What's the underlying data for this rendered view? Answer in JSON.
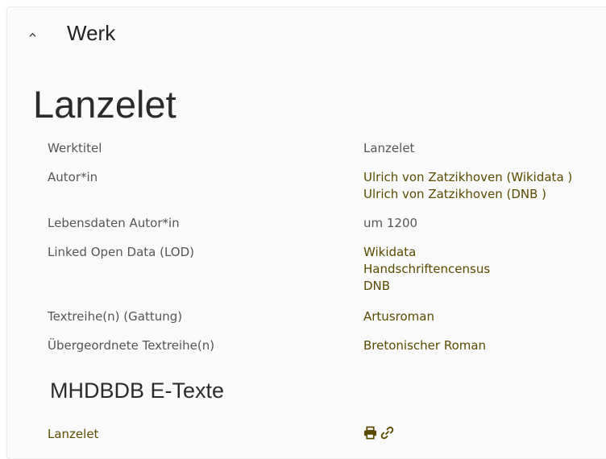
{
  "section": {
    "title": "Werk",
    "chevron_icon": "chevron-up-icon"
  },
  "work": {
    "title": "Lanzelet",
    "fields": {
      "werktitel": {
        "label": "Werktitel",
        "value": "Lanzelet"
      },
      "autor": {
        "label": "Autor*in",
        "links": [
          "Ulrich von Zatzikhoven (Wikidata )",
          "Ulrich von Zatzikhoven (DNB )"
        ]
      },
      "lebensdaten": {
        "label": "Lebensdaten Autor*in",
        "value": "um 1200"
      },
      "lod": {
        "label": "Linked Open Data (LOD)",
        "links": [
          "Wikidata",
          "Handschriftencensus",
          "DNB"
        ]
      },
      "textreihe": {
        "label": "Textreihe(n) (Gattung)",
        "link": "Artusroman"
      },
      "uebergeordnet": {
        "label": "Übergeordnete Textreihe(n)",
        "link": "Bretonischer Roman"
      }
    }
  },
  "etexte": {
    "heading": "MHDBDB E-Texte",
    "items": [
      {
        "title": "Lanzelet",
        "icons": [
          "print-icon",
          "link-icon"
        ]
      }
    ]
  },
  "colors": {
    "link": "#5a4a00",
    "text": "#555555",
    "heading": "#2b2b2b"
  }
}
